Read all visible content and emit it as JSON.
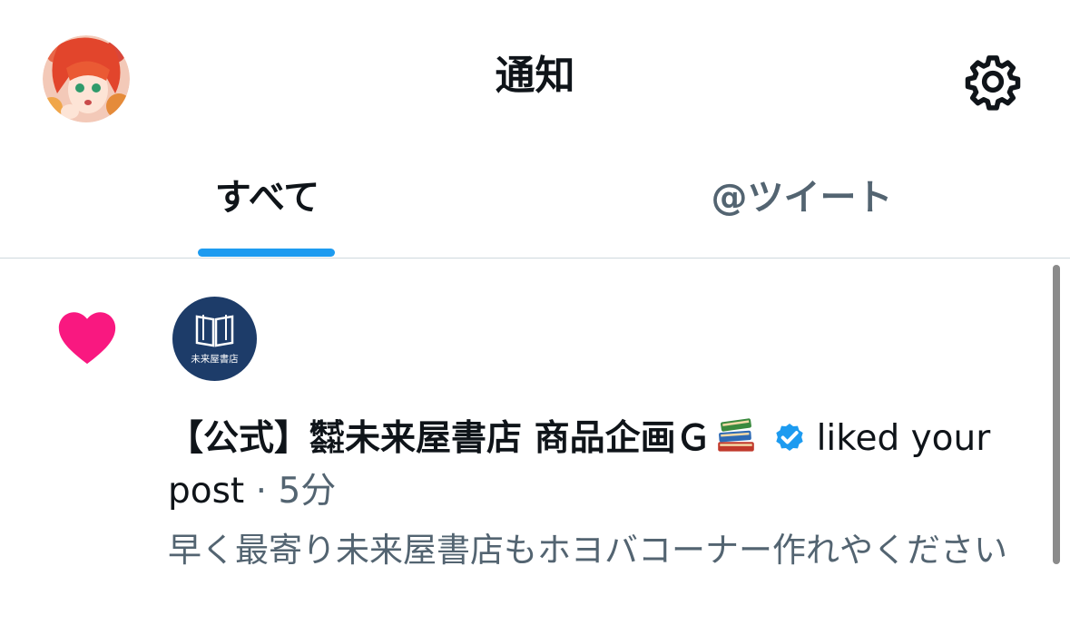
{
  "header": {
    "title": "通知",
    "avatar_icon": "profile-avatar-icon",
    "settings_icon": "gear-icon"
  },
  "tabs": [
    {
      "label": "すべて",
      "active": true
    },
    {
      "label": "@ツイート",
      "active": false
    }
  ],
  "notifications": [
    {
      "type_icon": "heart-icon",
      "actor_avatar_text": "未来屋書店",
      "actor_name": "【公式】㍿未来屋書店 商品企画Ｇ",
      "verified": true,
      "action": "liked your",
      "action_continued": "post",
      "separator": " · ",
      "time": "5分",
      "snippet": "早く最寄り未来屋書店もホヨバコーナー作れやください"
    }
  ],
  "colors": {
    "accent": "#1d9bf0",
    "heart": "#f91880",
    "secondary_text": "#536471",
    "actor_avatar_bg": "#1d3c69"
  }
}
